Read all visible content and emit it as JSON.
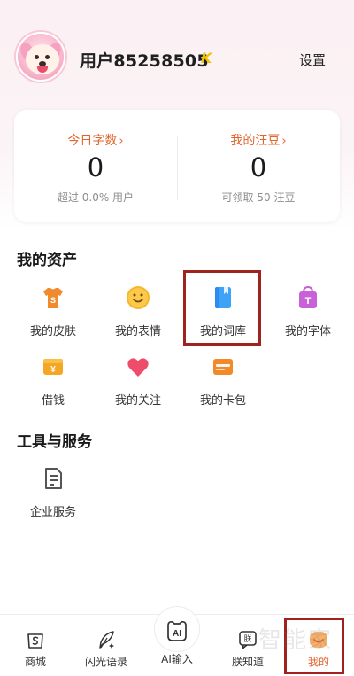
{
  "header": {
    "username": "用户85258505",
    "vip_badge": "K",
    "settings_label": "设置"
  },
  "stats": {
    "left": {
      "title": "今日字数",
      "chevron": "›",
      "value": "0",
      "sub": "超过 0.0% 用户"
    },
    "right": {
      "title": "我的汪豆",
      "chevron": "›",
      "value": "0",
      "sub": "可领取 50 汪豆"
    }
  },
  "assets": {
    "title": "我的资产",
    "items": [
      {
        "label": "我的皮肤",
        "icon": "tshirt-icon",
        "color": "#f08a2c"
      },
      {
        "label": "我的表情",
        "icon": "smiley-icon",
        "color": "#f7b62c"
      },
      {
        "label": "我的词库",
        "icon": "book-icon",
        "color": "#2f8bf0"
      },
      {
        "label": "我的字体",
        "icon": "shopping-bag-icon",
        "color": "#c860d8"
      },
      {
        "label": "借钱",
        "icon": "yen-card-icon",
        "color": "#f5a623"
      },
      {
        "label": "我的关注",
        "icon": "heart-icon",
        "color": "#ef4b6b"
      },
      {
        "label": "我的卡包",
        "icon": "wallet-icon",
        "color": "#f28a2a"
      }
    ]
  },
  "tools": {
    "title": "工具与服务",
    "items": [
      {
        "label": "企业服务",
        "icon": "document-icon"
      }
    ]
  },
  "bottom_nav": [
    {
      "label": "商城",
      "icon": "shop-bag-icon"
    },
    {
      "label": "闪光语录",
      "icon": "quill-icon"
    },
    {
      "label": "AI输入",
      "icon": "ai-icon",
      "icon_text": "AI"
    },
    {
      "label": "朕知道",
      "icon": "chat-icon",
      "icon_text": "朕"
    },
    {
      "label": "我的",
      "icon": "profile-icon",
      "active": true
    }
  ],
  "watermark": "智能家",
  "accent_color": "#e2642c",
  "highlight_color": "#a0221f"
}
